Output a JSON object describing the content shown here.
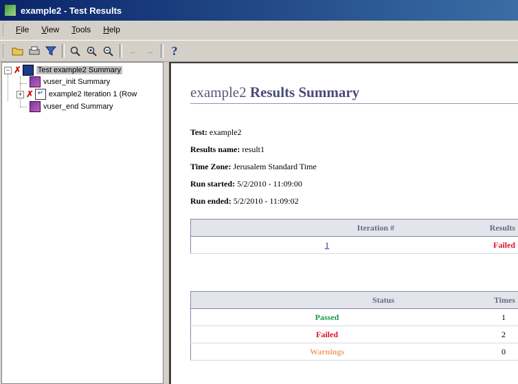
{
  "window": {
    "title": "example2 - Test Results"
  },
  "menu": {
    "items": [
      {
        "label": "File",
        "u": "F",
        "rest": "ile"
      },
      {
        "label": "View",
        "u": "V",
        "rest": "iew"
      },
      {
        "label": "Tools",
        "u": "T",
        "rest": "ools"
      },
      {
        "label": "Help",
        "u": "H",
        "rest": "elp"
      }
    ]
  },
  "toolbar": {
    "icons": [
      "open-folder-icon",
      "print-icon",
      "filter-icon",
      "find-icon",
      "zoom-in-icon",
      "zoom-out-icon",
      "back-arrow-icon",
      "forward-arrow-icon",
      "help-icon"
    ],
    "help_glyph": "?"
  },
  "tree": {
    "root": "Test example2 Summary",
    "init": "vuser_init Summary",
    "iteration": "example2 Iteration 1 (Row",
    "end": "vuser_end Summary"
  },
  "summary": {
    "title_prefix": "example2",
    "title_suffix": "Results Summary",
    "test_label": "Test:",
    "test_value": "example2",
    "results_label": "Results name:",
    "results_value": "result1",
    "tz_label": "Time Zone:",
    "tz_value": "Jerusalem Standard Time",
    "started_label": "Run started:",
    "started_value": "5/2/2010 - 11:09:00",
    "ended_label": "Run ended:",
    "ended_value": "5/2/2010 - 11:09:02"
  },
  "iterations_table": {
    "headers": [
      "Iteration #",
      "Results"
    ],
    "rows": [
      {
        "iteration": "1",
        "result": "Failed"
      }
    ]
  },
  "status_table": {
    "headers": [
      "Status",
      "Times"
    ],
    "rows": [
      {
        "status": "Passed",
        "times": "1"
      },
      {
        "status": "Failed",
        "times": "2"
      },
      {
        "status": "Warnings",
        "times": "0"
      }
    ]
  },
  "colors": {
    "passed": "#1a9a4a",
    "failed": "#e0102a",
    "warnings": "#f0a070",
    "titlebar": "#0a246a"
  }
}
